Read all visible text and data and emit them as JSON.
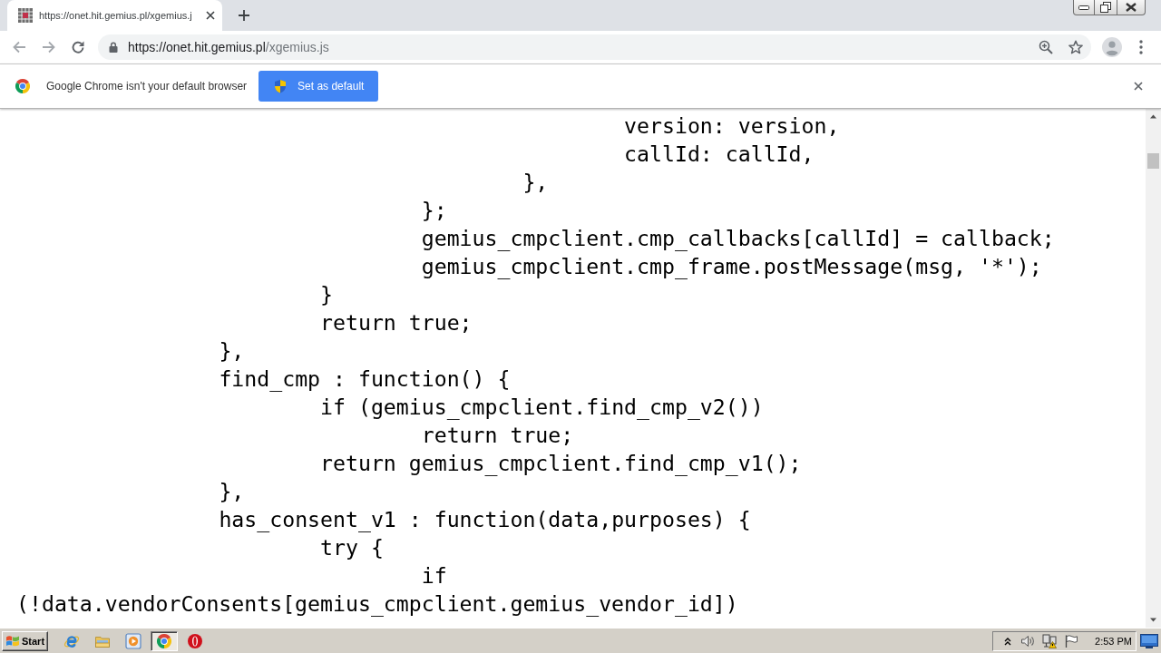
{
  "browser": {
    "tabs": [
      {
        "title": "https://onet.hit.gemius.pl/xgemius.j",
        "selected": true
      }
    ],
    "address_bar": {
      "host": "https://onet.hit.gemius.pl",
      "path": "/xgemius.js"
    }
  },
  "infobar": {
    "message": "Google Chrome isn't your default browser",
    "button": "Set as default"
  },
  "code_lines": [
    "\t\t\t\t\t\tversion: version,",
    "\t\t\t\t\t\tcallId: callId,",
    "\t\t\t\t\t},",
    "\t\t\t\t};",
    "\t\t\t\tgemius_cmpclient.cmp_callbacks[callId] = callback;",
    "\t\t\t\tgemius_cmpclient.cmp_frame.postMessage(msg, '*');",
    "\t\t\t}",
    "\t\t\treturn true;",
    "\t\t},",
    "\t\tfind_cmp : function() {",
    "\t\t\tif (gemius_cmpclient.find_cmp_v2())",
    "\t\t\t\treturn true;",
    "\t\t\treturn gemius_cmpclient.find_cmp_v1();",
    "\t\t},",
    "\t\thas_consent_v1 : function(data,purposes) {",
    "\t\t\ttry {",
    "\t\t\t\tif",
    "(!data.vendorConsents[gemius_cmpclient.gemius_vendor_id])"
  ],
  "taskbar": {
    "start": "Start",
    "apps": [
      {
        "kind": "e_logo",
        "selected": false
      },
      {
        "kind": "folder",
        "selected": false
      },
      {
        "kind": "player",
        "selected": false
      },
      {
        "kind": "tricolor",
        "selected": true
      },
      {
        "kind": "o_logo",
        "selected": false
      }
    ],
    "clock": "2:53 PM"
  }
}
